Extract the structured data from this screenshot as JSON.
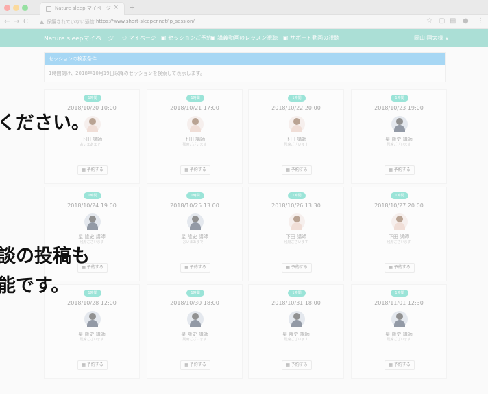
{
  "browser": {
    "tab_title": "Nature sleep マイページ",
    "tab_close": "×",
    "new_tab": "+",
    "back": "←",
    "forward": "→",
    "reload": "C",
    "lock": "▲",
    "security_label": "保護されていない通信",
    "url": "https://www.short-sleeper.net/lp_session/"
  },
  "site": {
    "brand": "Nature sleepマイページ",
    "nav": [
      "マイページ",
      "セッションご予約",
      "講義動画のレッスン視聴",
      "サポート動画の視聴"
    ],
    "user": "岡山 翔太様 ∨"
  },
  "conditions": {
    "title": "セッションの検索条件",
    "body": "1時間刻け、2018年10月19日以降のセッションを検索して表示します。"
  },
  "cards": [
    {
      "badge": "1時間",
      "datetime": "2018/10/20 10:00",
      "teacher": "下田 講師",
      "message": "おいまあまで！",
      "avatar": "f",
      "reserve": "予約する"
    },
    {
      "badge": "1時間",
      "datetime": "2018/10/21 17:00",
      "teacher": "下田 講師",
      "message": "残席ございます",
      "avatar": "f",
      "reserve": "予約する"
    },
    {
      "badge": "1時間",
      "datetime": "2018/10/22 20:00",
      "teacher": "下田 講師",
      "message": "残席ございます",
      "avatar": "f",
      "reserve": "予約する"
    },
    {
      "badge": "1時間",
      "datetime": "2018/10/23 19:00",
      "teacher": "星 隆史 講師",
      "message": "残席ございます",
      "avatar": "m",
      "reserve": "予約する"
    },
    {
      "badge": "1時間",
      "datetime": "2018/10/24 19:00",
      "teacher": "星 隆史 講師",
      "message": "残席ございます",
      "avatar": "m",
      "reserve": "予約する"
    },
    {
      "badge": "1時間",
      "datetime": "2018/10/25 13:00",
      "teacher": "星 隆史 講師",
      "message": "おいまあまで！",
      "avatar": "m",
      "reserve": "予約する"
    },
    {
      "badge": "1時間",
      "datetime": "2018/10/26 13:30",
      "teacher": "下田 講師",
      "message": "残席ございます",
      "avatar": "f",
      "reserve": "予約する"
    },
    {
      "badge": "1時間",
      "datetime": "2018/10/27 20:00",
      "teacher": "下田 講師",
      "message": "残席ございます",
      "avatar": "f",
      "reserve": "予約する"
    },
    {
      "badge": "1時間",
      "datetime": "2018/10/28 12:00",
      "teacher": "星 隆史 講師",
      "message": "残席ございます",
      "avatar": "m",
      "reserve": "予約する"
    },
    {
      "badge": "1時間",
      "datetime": "2018/10/30 18:00",
      "teacher": "星 隆史 講師",
      "message": "残席ございます",
      "avatar": "m",
      "reserve": "予約する"
    },
    {
      "badge": "1時間",
      "datetime": "2018/10/31 18:00",
      "teacher": "星 隆史 講師",
      "message": "残席ございます",
      "avatar": "m",
      "reserve": "予約する"
    },
    {
      "badge": "1時間",
      "datetime": "2018/11/01 12:30",
      "teacher": "星 隆史 講師",
      "message": "残席ございます",
      "avatar": "m",
      "reserve": "予約する"
    }
  ],
  "overlay": {
    "line1": "ください。",
    "line2": "談の投稿も",
    "line3": "能です。"
  },
  "colors": {
    "nav_bar": "#5ec6b4",
    "panel_header": "#56b6f0",
    "badge": "#3ed0b8"
  }
}
